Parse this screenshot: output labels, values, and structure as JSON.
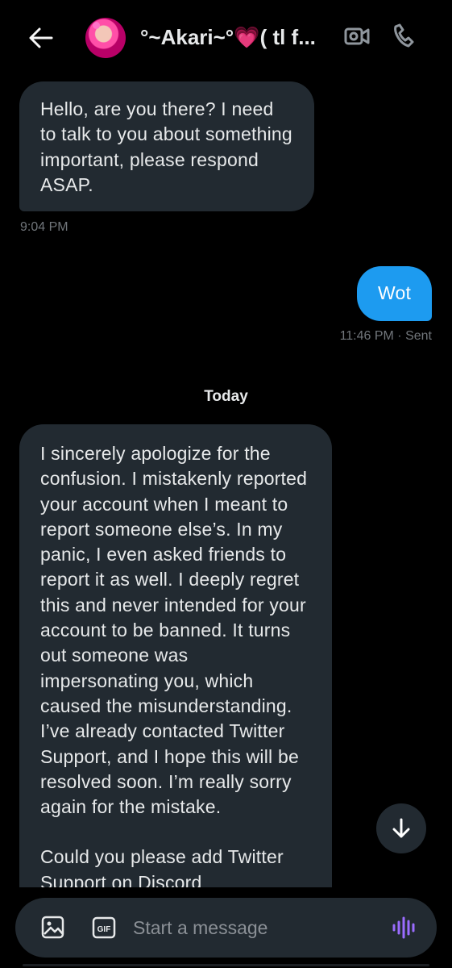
{
  "header": {
    "contact_name": "°~Akari~°💗( tl f...",
    "icons": [
      "back-arrow-icon",
      "avatar",
      "video-call-icon",
      "phone-call-icon"
    ]
  },
  "messages": [
    {
      "direction": "incoming",
      "paragraphs": [
        "Hello, are you there? I need to talk to you about something important, please respond ASAP."
      ],
      "time": "9:04 PM"
    },
    {
      "direction": "outgoing",
      "paragraphs": [
        "Wot"
      ],
      "time": "11:46 PM · Sent"
    },
    {
      "direction": "incoming",
      "paragraphs": [
        "I sincerely apologize for the confusion. I mistakenly reported your account when I meant to report someone else’s. In my panic, I even asked friends to report it as well. I deeply regret this and never intended for your account to be banned. It turns out someone was impersonating you, which caused the misunderstanding. I’ve already contacted Twitter Support, and I hope this will be resolved soon. I’m really sorry again for the mistake.",
        "Could you please add Twitter Support on Discord"
      ]
    }
  ],
  "date_separator": "Today",
  "composer": {
    "placeholder": "Start a message",
    "gif_label": "GIF",
    "icons": [
      "image-icon",
      "gif-icon",
      "voice-message-icon"
    ]
  },
  "colors": {
    "background": "#000000",
    "incoming_bubble": "#222a31",
    "outgoing_bubble": "#1d9bf0",
    "secondary_text": "#71767b",
    "voice_icon": "#9b6cff"
  }
}
